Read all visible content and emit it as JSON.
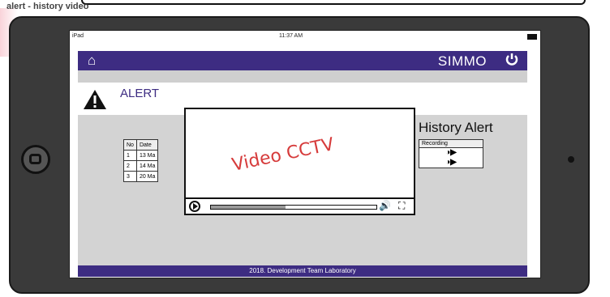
{
  "caption": "alert - history video",
  "status": {
    "carrier": "iPad",
    "time": "11:37 AM"
  },
  "navbar": {
    "brand": "SIMMO"
  },
  "alert": {
    "label": "ALERT"
  },
  "history": {
    "title": "History Alert"
  },
  "table": {
    "headers": [
      "No",
      "Date"
    ],
    "rows": [
      {
        "no": "1",
        "date": "13 Ma"
      },
      {
        "no": "2",
        "date": "14 Ma"
      },
      {
        "no": "3",
        "date": "20 Ma"
      }
    ]
  },
  "recording": {
    "header": "Recording",
    "rows": [
      "◑▶",
      "◑▶"
    ]
  },
  "footer": "2018. Development Team Laboratory",
  "video": {
    "title": "Video CCTV",
    "progress": 0.45
  },
  "colors": {
    "primary": "#3d2c82",
    "video_title": "#d63b3b"
  }
}
